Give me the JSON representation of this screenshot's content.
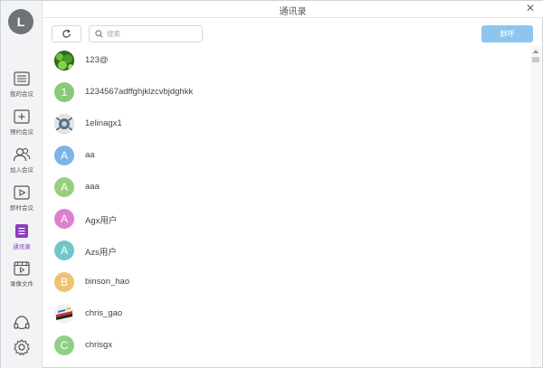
{
  "window": {
    "title": "通讯录",
    "close_glyph": "✕"
  },
  "user": {
    "initial": "L"
  },
  "sidebar": {
    "items": [
      {
        "label": "我的会议",
        "icon": "list-icon",
        "active": false
      },
      {
        "label": "预约会议",
        "icon": "calendar-plus-icon",
        "active": false
      },
      {
        "label": "加入会议",
        "icon": "users-icon",
        "active": false
      },
      {
        "label": "即时会议",
        "icon": "video-icon",
        "active": false
      },
      {
        "label": "通讯录",
        "icon": "contacts-icon",
        "active": true
      },
      {
        "label": "录像文件",
        "icon": "film-icon",
        "active": false
      }
    ],
    "bottom": [
      {
        "icon": "headset-icon"
      },
      {
        "icon": "gear-icon"
      }
    ]
  },
  "toolbar": {
    "search_placeholder": "搜索",
    "group_button": "群呼"
  },
  "contacts": [
    {
      "name": "123@",
      "avatar": "photo",
      "initial": "",
      "color": "#3f7a2a"
    },
    {
      "name": "1234567adffghjklzcvbjdghkk",
      "avatar": "letter",
      "initial": "1",
      "color": "#8bc87a"
    },
    {
      "name": "1elinagx1",
      "avatar": "photo",
      "initial": "",
      "color": "#6b7c8c"
    },
    {
      "name": "aa",
      "avatar": "letter",
      "initial": "A",
      "color": "#7db3e6"
    },
    {
      "name": "aaa",
      "avatar": "letter",
      "initial": "A",
      "color": "#98cf7e"
    },
    {
      "name": "Agx用户",
      "avatar": "letter",
      "initial": "A",
      "color": "#e07fcf"
    },
    {
      "name": "Azs用户",
      "avatar": "letter",
      "initial": "A",
      "color": "#6fc7c9"
    },
    {
      "name": "binson_hao",
      "avatar": "letter",
      "initial": "B",
      "color": "#f1c173"
    },
    {
      "name": "chris_gao",
      "avatar": "photo",
      "initial": "",
      "color": "#c0392b"
    },
    {
      "name": "chrisgx",
      "avatar": "letter",
      "initial": "C",
      "color": "#8fcf86"
    }
  ],
  "colors": {
    "accent": "#8b3bbf",
    "button_blue": "#8ec5ee",
    "sidebar_bg": "#f2f3f5"
  }
}
